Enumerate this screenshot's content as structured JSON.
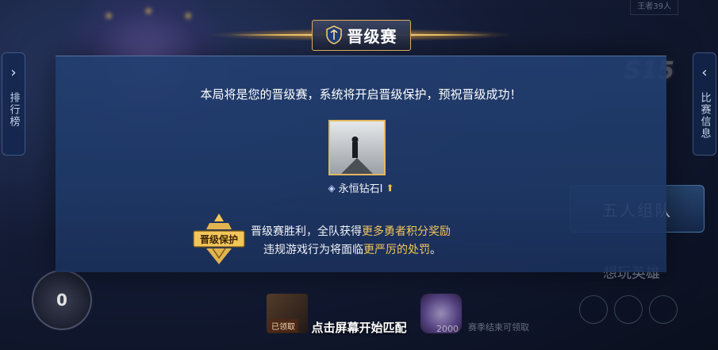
{
  "background": {
    "left_tab_label": "排行榜",
    "right_tab_label": "比赛信息",
    "top_counter": "王者39人",
    "season_logo": "S15",
    "five_team_button": "五人组队",
    "want_hero": "想玩英雄",
    "rank_points": "0",
    "reward1_tag": "已领取",
    "reward2_value": "2000",
    "reward2_sub": "赛季结束可领取"
  },
  "modal": {
    "title": "晋级赛",
    "message": "本局将是您的晋级赛，系统将开启晋级保护，预祝晋级成功！",
    "rank_name": "永恒钻石I",
    "badge_text": "晋级保护",
    "line1_prefix": "晋级赛胜利，全队获得",
    "line1_highlight": "更多勇者积分奖励",
    "line2_prefix": "违规游戏行为将面临",
    "line2_highlight": "更严厉的处罚",
    "line2_suffix": "。"
  },
  "bottom_hint": "点击屏幕开始匹配",
  "colors": {
    "gold": "#f3c65a",
    "modal_bg": "#223e70",
    "frame_gold": "#e2b85e"
  }
}
